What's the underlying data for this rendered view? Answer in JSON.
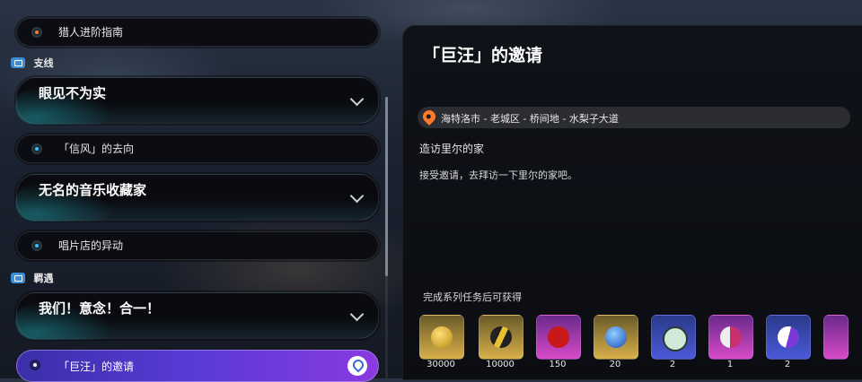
{
  "quest_list": {
    "main_item": "猎人进阶指南",
    "section_side": {
      "label": "支线"
    },
    "side_groups": [
      {
        "title": "眼见不为实",
        "sub": "「信风」的去向"
      },
      {
        "title": "无名的音乐收藏家",
        "sub": "唱片店的异动"
      }
    ],
    "section_encounter": {
      "label": "羁遇"
    },
    "encounter_group": {
      "title": "我们！意念！合一！"
    },
    "selected_item": "「巨汪」的邀请"
  },
  "detail": {
    "title": "「巨汪」的邀请",
    "location": "海特洛市 - 老城区 - 桥间地 - 水梨子大道",
    "subtitle": "造访里尔的家",
    "description": "接受邀请，去拜访一下里尔的家吧。",
    "rewards_header": "完成系列任务后可获得",
    "rewards": [
      {
        "icon": "gold-coin-icon",
        "count": "30000"
      },
      {
        "icon": "card-ticket-icon",
        "count": "10000"
      },
      {
        "icon": "red-emblem-icon",
        "count": "150"
      },
      {
        "icon": "blue-sphere-icon",
        "count": "20"
      },
      {
        "icon": "disc-pack-icon",
        "count": "2"
      },
      {
        "icon": "card-pack-icon",
        "count": "1"
      },
      {
        "icon": "tube-item-icon",
        "count": "2"
      }
    ]
  },
  "colors": {
    "selected_start": "#3a2fa8",
    "selected_end": "#8a3ae0",
    "accent_blue": "#3ac2ff",
    "accent_orange": "#ff7a2a"
  }
}
